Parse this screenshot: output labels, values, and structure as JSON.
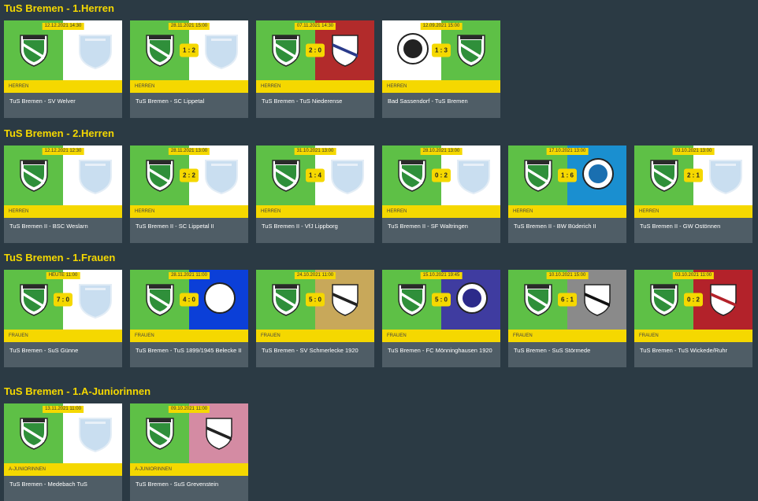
{
  "colors": {
    "background": "#2b3a44",
    "accent_yellow": "#f5d800",
    "home_green": "#5ec046",
    "card_footer": "#4f5d66"
  },
  "sections": [
    {
      "title": "TuS Bremen - 1.Herren",
      "matches": [
        {
          "date": "12.12.2021 14:30",
          "score": "",
          "league": "Herren",
          "teams": "TuS Bremen - SV Welver",
          "left": "tus",
          "right": "placeholder"
        },
        {
          "date": "28.11.2021 15:00",
          "score": "1 : 2",
          "league": "Herren",
          "teams": "TuS Bremen - SC Lippetal",
          "left": "tus",
          "right": "placeholder"
        },
        {
          "date": "07.11.2021 14:30",
          "score": "2 : 0",
          "league": "Herren",
          "teams": "TuS Bremen - TuS Niederense",
          "left": "tus",
          "right": "niederense"
        },
        {
          "date": "12.09.2021 15:00",
          "score": "1 : 3",
          "league": "Herren",
          "teams": "Bad Sassendorf - TuS Bremen",
          "left": "sassendorf",
          "right": "tus"
        }
      ]
    },
    {
      "title": "TuS Bremen - 2.Herren",
      "matches": [
        {
          "date": "12.12.2021 12:30",
          "score": "",
          "league": "Herren",
          "teams": "TuS Bremen II - BSC Weslarn",
          "left": "tus",
          "right": "placeholder"
        },
        {
          "date": "28.11.2021 13:00",
          "score": "2 : 2",
          "league": "Herren",
          "teams": "TuS Bremen II - SC Lippetal II",
          "left": "tus",
          "right": "placeholder"
        },
        {
          "date": "31.10.2021 13:00",
          "score": "1 : 4",
          "league": "Herren",
          "teams": "TuS Bremen II - VfJ Lippborg",
          "left": "tus",
          "right": "placeholder"
        },
        {
          "date": "28.10.2021 13:00",
          "score": "0 : 2",
          "league": "Herren",
          "teams": "TuS Bremen II - SF Waltringen",
          "left": "tus",
          "right": "placeholder"
        },
        {
          "date": "17.10.2021 13:00",
          "score": "1 : 6",
          "league": "Herren",
          "teams": "TuS Bremen II - BW Büderich II",
          "left": "tus",
          "right": "djk"
        },
        {
          "date": "03.10.2021 13:00",
          "score": "2 : 1",
          "league": "Herren",
          "teams": "TuS Bremen II - GW Ostönnen",
          "left": "tus",
          "right": "placeholder"
        }
      ]
    },
    {
      "title": "TuS Bremen - 1.Frauen",
      "matches": [
        {
          "date": "HEUTE 11:00",
          "score": "7 : 0",
          "league": "Frauen",
          "teams": "TuS Bremen - SuS Günne",
          "left": "tus",
          "right": "placeholder"
        },
        {
          "date": "28.11.2021 11:00",
          "score": "4 : 0",
          "league": "Frauen",
          "teams": "TuS Bremen - TuS 1899/1945 Belecke II",
          "left": "tus",
          "right": "belecke"
        },
        {
          "date": "24.10.2021 11:00",
          "score": "5 : 0",
          "league": "Frauen",
          "teams": "TuS Bremen - SV Schmerlecke 1920",
          "left": "tus",
          "right": "schmerlecke"
        },
        {
          "date": "15.10.2021 19:45",
          "score": "5 : 0",
          "league": "Frauen",
          "teams": "TuS Bremen - FC Mönninghausen 1920",
          "left": "tus",
          "right": "moenninghausen"
        },
        {
          "date": "10.10.2021 15:00",
          "score": "6 : 1",
          "league": "Frauen",
          "teams": "TuS Bremen - SuS Störmede",
          "left": "tus",
          "right": "stoermede"
        },
        {
          "date": "03.10.2021 11:00",
          "score": "0 : 2",
          "league": "Frauen",
          "teams": "TuS Bremen - TuS Wickede/Ruhr",
          "left": "tus",
          "right": "wickede"
        }
      ]
    },
    {
      "title": "TuS Bremen - 1.A-Juniorinnen",
      "matches": [
        {
          "date": "13.11.2021 11:00",
          "score": "",
          "league": "A-Juniorinnen",
          "teams": "TuS Bremen - Medebach TuS",
          "left": "tus",
          "right": "placeholder"
        },
        {
          "date": "09.10.2021 11:00",
          "score": "",
          "league": "A-Juniorinnen",
          "teams": "TuS Bremen - SuS Grevenstein",
          "left": "tus",
          "right": "grevenstein"
        }
      ]
    }
  ]
}
